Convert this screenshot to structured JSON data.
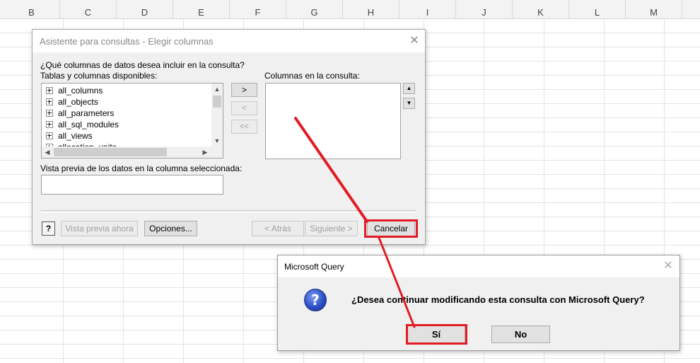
{
  "sheet": {
    "columns": [
      "B",
      "C",
      "D",
      "E",
      "F",
      "G",
      "H",
      "I",
      "J",
      "K",
      "L",
      "M"
    ]
  },
  "wizard": {
    "title": "Asistente para consultas - Elegir columnas",
    "question": "¿Qué columnas de datos desea incluir en la consulta?",
    "available_label": "Tablas y columnas disponibles:",
    "query_columns_label": "Columnas en la consulta:",
    "preview_label": "Vista previa de los datos en la columna seleccionada:",
    "available_items": [
      "all_columns",
      "all_objects",
      "all_parameters",
      "all_sql_modules",
      "all_views",
      "allocation_units"
    ],
    "add_button": ">",
    "remove_button": "<",
    "remove_all_button": "<<",
    "help_icon": "?",
    "preview_now_button": "Vista previa ahora",
    "options_button": "Opciones...",
    "back_button": "< Atrás",
    "next_button": "Siguiente >",
    "cancel_button": "Cancelar",
    "close_glyph": "✕"
  },
  "confirm": {
    "title": "Microsoft Query",
    "message": "¿Desea continuar modificando esta consulta con Microsoft Query?",
    "icon_glyph": "?",
    "yes_button": "Sí",
    "no_button": "No",
    "close_glyph": "✕"
  },
  "colors": {
    "highlight": "#e21c25",
    "dialog_bg": "#f0f0f0"
  }
}
